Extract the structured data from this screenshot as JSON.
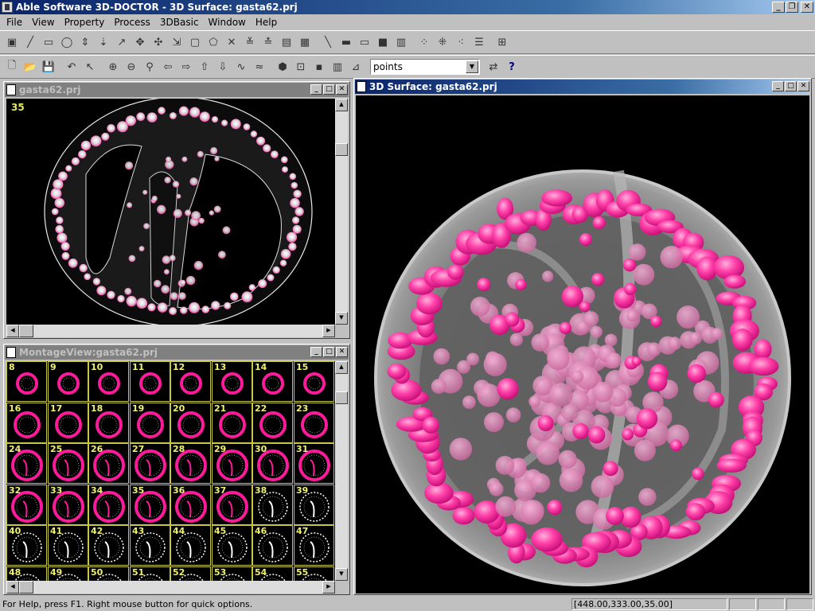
{
  "app": {
    "title": "Able Software 3D-DOCTOR - 3D Surface: gasta62.prj",
    "window_controls": [
      "_",
      "❐",
      "✕"
    ]
  },
  "menu": [
    {
      "label": "File",
      "name": "menu-file"
    },
    {
      "label": "View",
      "name": "menu-view"
    },
    {
      "label": "Property",
      "name": "menu-property"
    },
    {
      "label": "Process",
      "name": "menu-process"
    },
    {
      "label": "3DBasic",
      "name": "menu-3dbasic"
    },
    {
      "label": "Window",
      "name": "menu-window"
    },
    {
      "label": "Help",
      "name": "menu-help"
    }
  ],
  "toolbar1": [
    "select-icon",
    "pencil-icon",
    "rectangle-icon",
    "ellipse-icon",
    "move-vertical-icon",
    "move-down-icon",
    "arrow-diagonal-icon",
    "cross-move-icon",
    "multi-move-icon",
    "scale-icon",
    "box-icon",
    "polygon-icon",
    "delete-icon",
    "sort-down-icon",
    "sort-up-icon",
    "image-icon",
    "grid-icon",
    "line-icon",
    "frame-icon",
    "panel-icon",
    "fill-icon",
    "chart-icon",
    "point-icon",
    "add-point-icon",
    "remove-point-icon",
    "list-icon",
    "align-icon"
  ],
  "toolbar1_glyphs": [
    "▣",
    "╱",
    "▭",
    "◯",
    "⇕",
    "⇣",
    "↗",
    "✥",
    "✣",
    "⇲",
    "▢",
    "⬠",
    "✕",
    "≚",
    "≛",
    "▤",
    "▦",
    "╲",
    "▬",
    "▭",
    "■",
    "▥",
    "⁘",
    "⁜",
    "⁖",
    "☰",
    "⊞"
  ],
  "toolbar2": [
    "new-file-icon",
    "open-folder-icon",
    "save-icon",
    "undo-icon",
    "pointer-icon",
    "zoom-in-icon",
    "zoom-out-icon",
    "pan-icon",
    "arrow-left-icon",
    "arrow-right-icon",
    "arrow-up-icon",
    "arrow-down-icon",
    "wave-icon",
    "wave-alt-icon",
    "shape-icon",
    "fit-icon",
    "slice-icon",
    "sequence-icon",
    "filter-icon"
  ],
  "toolbar2_glyphs": [
    "🗋",
    "📂",
    "💾",
    "↶",
    "↖",
    "⊕",
    "⊖",
    "⚲",
    "⇦",
    "⇨",
    "⇧",
    "⇩",
    "∿",
    "≈",
    "⬢",
    "⊡",
    "▪",
    "▥",
    "⊿"
  ],
  "render_combo": {
    "value": "points"
  },
  "render_extra": [
    "render-icon",
    "context-help-icon"
  ],
  "render_extra_glyphs": [
    "⇄",
    "?"
  ],
  "windows": {
    "slice": {
      "title": "gasta62.prj",
      "slice_number": "35"
    },
    "montage": {
      "title": "MontageView:gasta62.prj",
      "cells": [
        [
          8,
          9,
          10,
          11,
          12,
          13,
          14,
          15
        ],
        [
          16,
          17,
          18,
          19,
          20,
          21,
          22,
          23
        ],
        [
          24,
          25,
          26,
          27,
          28,
          29,
          30,
          31
        ],
        [
          32,
          33,
          34,
          35,
          36,
          37,
          38,
          39
        ],
        [
          40,
          41,
          42,
          43,
          44,
          45,
          46,
          47
        ],
        [
          48,
          49,
          50,
          51,
          52,
          53,
          54,
          55
        ]
      ],
      "segmented_until": 37
    },
    "surface": {
      "title": "3D Surface: gasta62.prj"
    }
  },
  "colors": {
    "surface": "#ff1a9c",
    "cell_grid": "#c8c840",
    "slice_label": "#e8e85a"
  },
  "status": {
    "help": "For Help, press F1. Right mouse button for quick options.",
    "coords": "[448.00,333.00,35.00]"
  }
}
